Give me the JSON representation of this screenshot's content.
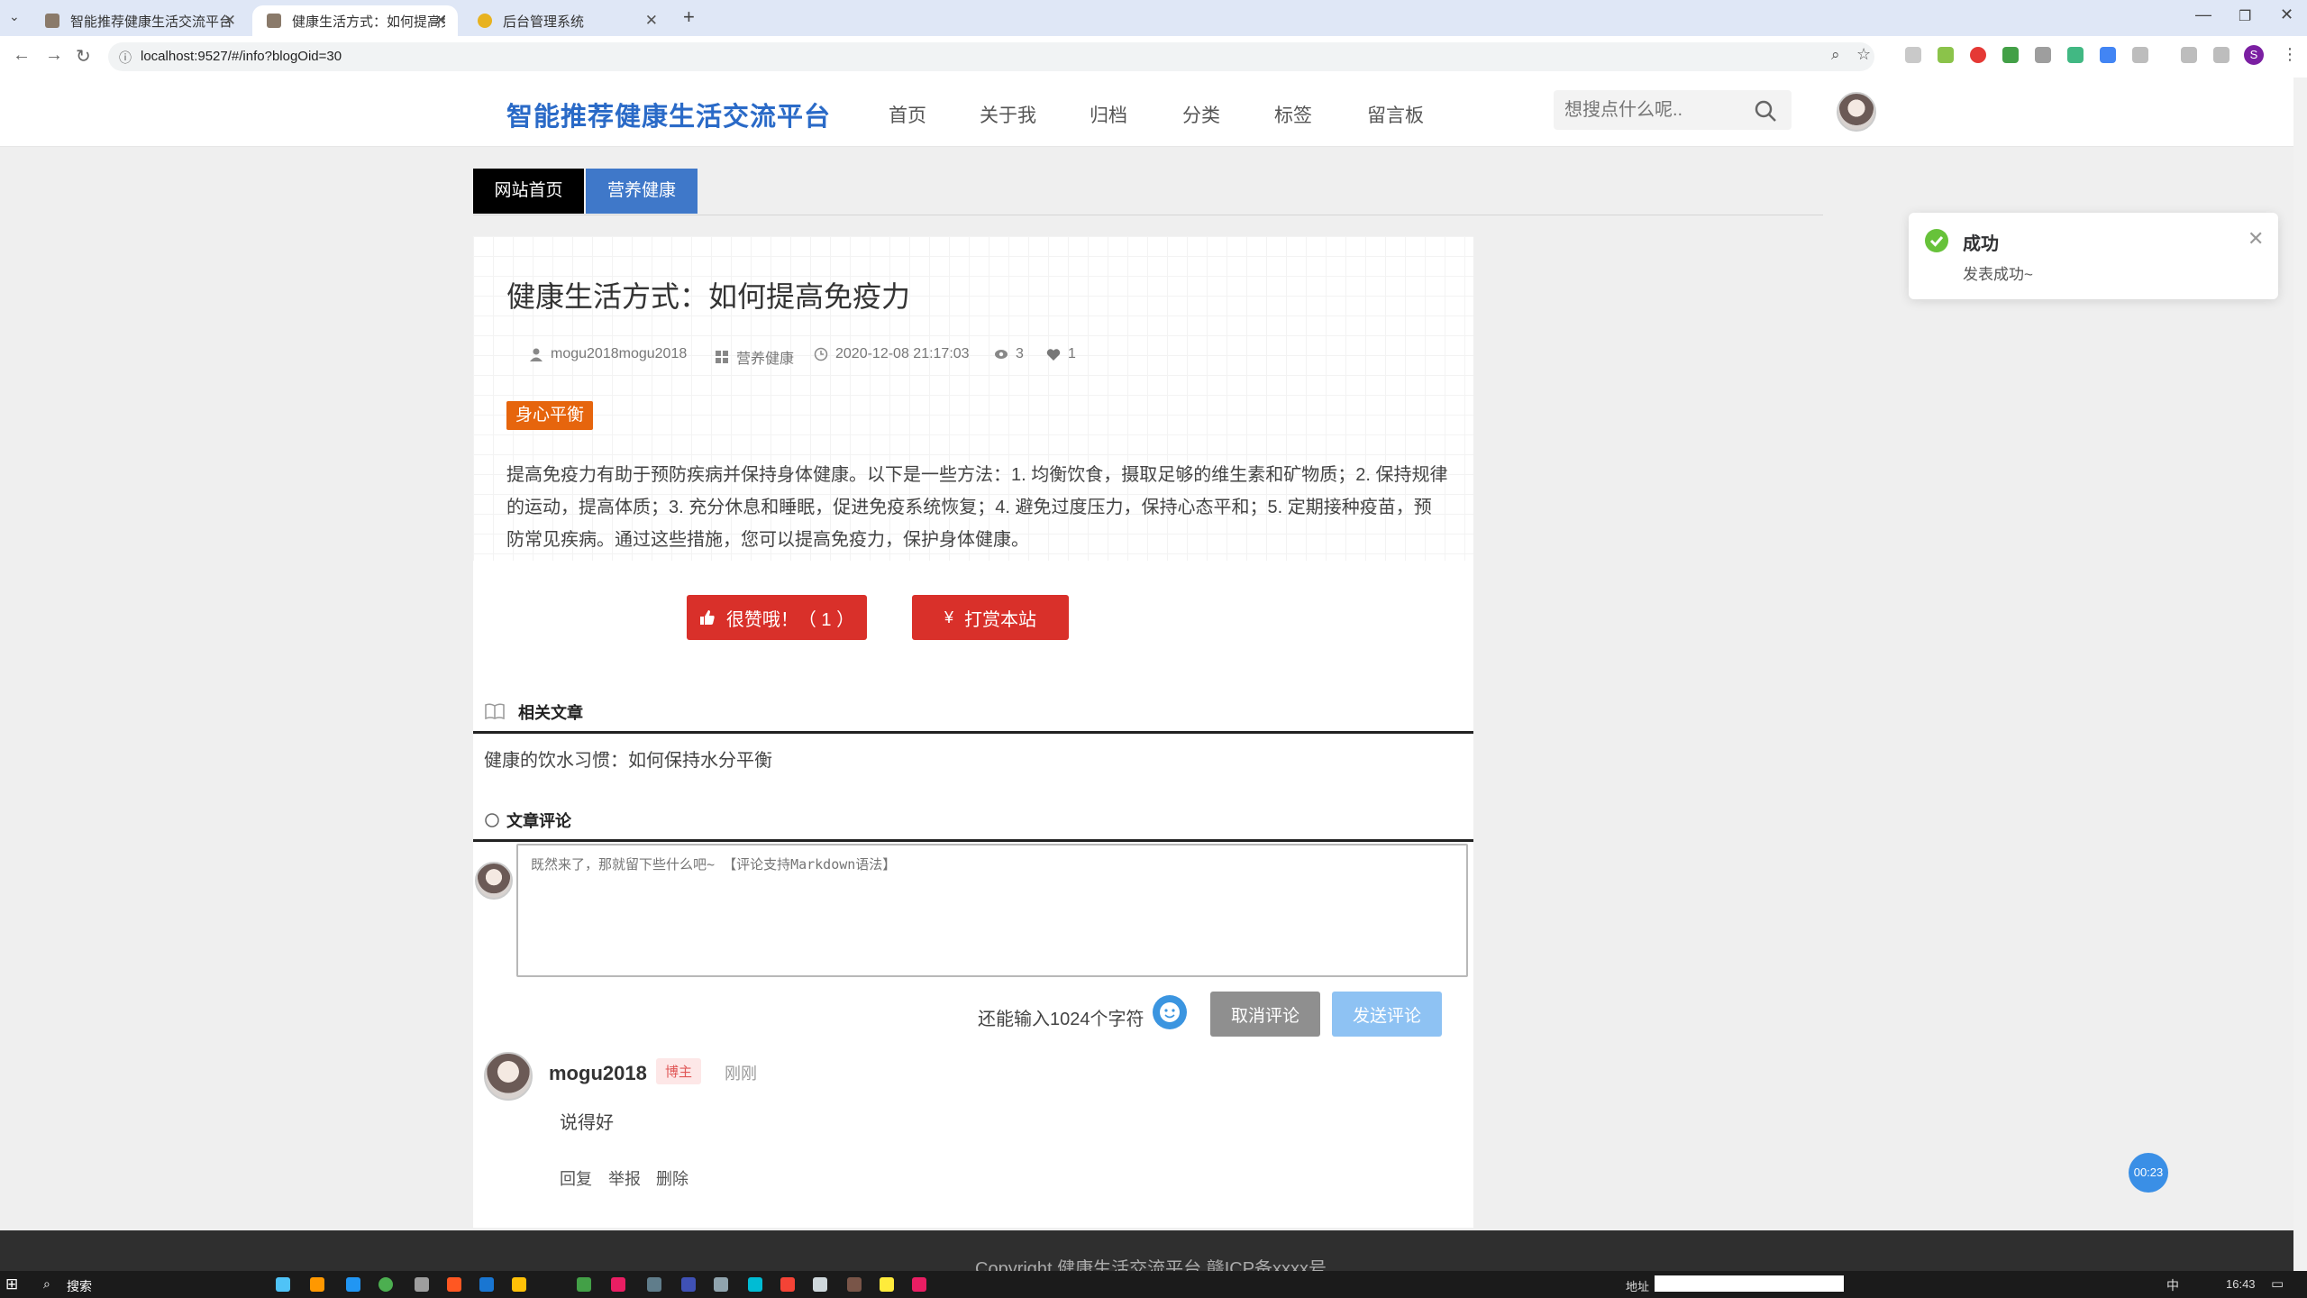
{
  "browser": {
    "tabs": [
      {
        "title": "智能推荐健康生活交流平台",
        "active": false
      },
      {
        "title": "健康生活方式：如何提高免疫力",
        "active": true
      },
      {
        "title": "后台管理系统",
        "active": false
      }
    ],
    "url": "localhost:9527/#/info?blogOid=30",
    "profile_initial": "S"
  },
  "site": {
    "logo": "智能推荐健康生活交流平台",
    "menu": [
      "首页",
      "关于我",
      "归档",
      "分类",
      "标签",
      "留言板"
    ],
    "search_placeholder": "想搜点什么呢.."
  },
  "breadcrumb": {
    "home": "网站首页",
    "category": "营养健康"
  },
  "article": {
    "title": "健康生活方式：如何提高免疫力",
    "author": "mogu2018mogu2018",
    "category": "营养健康",
    "date": "2020-12-08 21:17:03",
    "views": "3",
    "likes": "1",
    "tag": "身心平衡",
    "content": "提高免疫力有助于预防疾病并保持身体健康。以下是一些方法：1. 均衡饮食，摄取足够的维生素和矿物质；2. 保持规律的运动，提高体质；3. 充分休息和睡眠，促进免疫系统恢复；4. 避免过度压力，保持心态平和；5. 定期接种疫苗，预防常见疾病。通过这些措施，您可以提高免疫力，保护身体健康。",
    "like_button": "很赞哦！（ 1 ）",
    "reward_button": "打赏本站"
  },
  "related": {
    "heading": "相关文章",
    "items": [
      "健康的饮水习惯：如何保持水分平衡"
    ]
  },
  "comments": {
    "heading": "文章评论",
    "placeholder": "既然来了，那就留下些什么吧~ 【评论支持Markdown语法】",
    "remaining": "还能输入1024个字符",
    "cancel_label": "取消评论",
    "submit_label": "发送评论",
    "items": [
      {
        "user": "mogu2018",
        "badge": "博主",
        "time": "刚刚",
        "text": "说得好",
        "actions": [
          "回复",
          "举报",
          "删除"
        ]
      }
    ]
  },
  "footer": {
    "copyright": "Copyright  健康生活交流平台  赣ICP备xxxx号"
  },
  "toast": {
    "title": "成功",
    "message": "发表成功~",
    "status_color": "#67c23a"
  },
  "timer": "00:23",
  "taskbar": {
    "search": "搜索",
    "address_label": "地址",
    "ime": "中",
    "clock": "16:43"
  },
  "colors": {
    "brand": "#2a6ac7",
    "like": "#d9302a",
    "tag": "#e6650d",
    "crumb_active": "#3f78c9"
  }
}
